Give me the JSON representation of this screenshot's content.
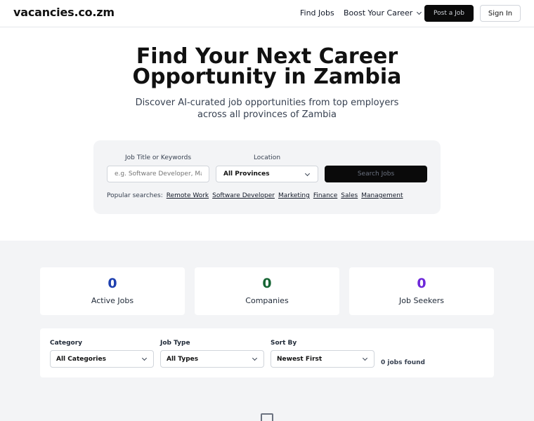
{
  "header": {
    "logo": "vacancies.co.zm",
    "nav": {
      "find_jobs": "Find Jobs",
      "boost_career": "Boost Your Career"
    },
    "post_job": "Post a Job",
    "sign_in": "Sign In"
  },
  "hero": {
    "title": "Find Your Next Career Opportunity in Zambia",
    "subtitle": "Discover AI-curated job opportunities from top employers across all provinces of Zambia"
  },
  "search": {
    "title_label": "Job Title or Keywords",
    "title_placeholder": "e.g. Software Developer, Marketing",
    "location_label": "Location",
    "location_value": "All Provinces",
    "button": "Search Jobs",
    "popular_label": "Popular searches:",
    "popular": [
      "Remote Work",
      "Software Developer",
      "Marketing",
      "Finance",
      "Sales",
      "Management"
    ]
  },
  "stats": [
    {
      "value": "0",
      "label": "Active Jobs",
      "color": "#1e40af"
    },
    {
      "value": "0",
      "label": "Companies",
      "color": "#166534"
    },
    {
      "value": "0",
      "label": "Job Seekers",
      "color": "#6d28d9"
    }
  ],
  "filters": {
    "category_label": "Category",
    "category_value": "All Categories",
    "type_label": "Job Type",
    "type_value": "All Types",
    "sort_label": "Sort By",
    "sort_value": "Newest First",
    "results": "0 jobs found"
  },
  "empty_state": {
    "icon": "empty-box-icon"
  }
}
